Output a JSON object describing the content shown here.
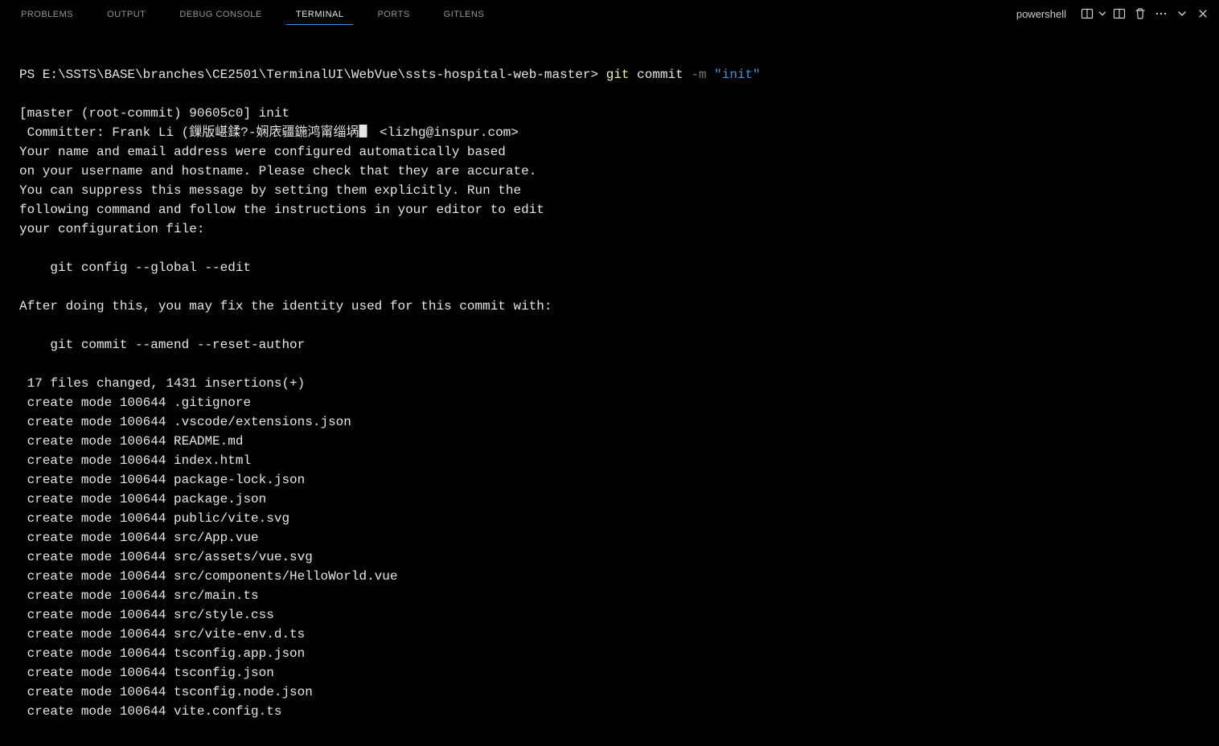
{
  "tabs": {
    "problems": "PROBLEMS",
    "output": "OUTPUT",
    "debug_console": "DEBUG CONSOLE",
    "terminal": "TERMINAL",
    "ports": "PORTS",
    "gitlens": "GITLENS"
  },
  "shell_name": "powershell",
  "prompt": {
    "prefix": "PS E:\\SSTS\\BASE\\branches\\CE2501\\TerminalUI\\WebVue\\ssts-hospital-web-master> ",
    "cmd": "git",
    "args": " commit ",
    "flag": "-m",
    "space": " ",
    "msg": "\"init\""
  },
  "output_lines": [
    "[master (root-commit) 90605c0] init",
    " Committer: Frank Li (鏁版嵁鍒?-娴庡疆鍦鸿甯缁埚▋ <lizhg@inspur.com>",
    "Your name and email address were configured automatically based",
    "on your username and hostname. Please check that they are accurate.",
    "You can suppress this message by setting them explicitly. Run the",
    "following command and follow the instructions in your editor to edit",
    "your configuration file:",
    "",
    "    git config --global --edit",
    "",
    "After doing this, you may fix the identity used for this commit with:",
    "",
    "    git commit --amend --reset-author",
    "",
    " 17 files changed, 1431 insertions(+)",
    " create mode 100644 .gitignore",
    " create mode 100644 .vscode/extensions.json",
    " create mode 100644 README.md",
    " create mode 100644 index.html",
    " create mode 100644 package-lock.json",
    " create mode 100644 package.json",
    " create mode 100644 public/vite.svg",
    " create mode 100644 src/App.vue",
    " create mode 100644 src/assets/vue.svg",
    " create mode 100644 src/components/HelloWorld.vue",
    " create mode 100644 src/main.ts",
    " create mode 100644 src/style.css",
    " create mode 100644 src/vite-env.d.ts",
    " create mode 100644 tsconfig.app.json",
    " create mode 100644 tsconfig.json",
    " create mode 100644 tsconfig.node.json",
    " create mode 100644 vite.config.ts"
  ]
}
